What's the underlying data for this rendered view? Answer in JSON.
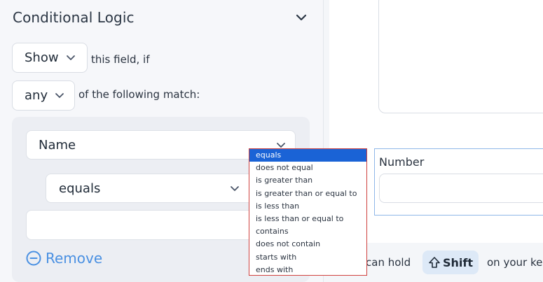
{
  "conditional_logic": {
    "title": "Conditional Logic",
    "action_select": {
      "value": "Show"
    },
    "action_suffix": "this field, if",
    "match_select": {
      "value": "any"
    },
    "match_suffix": "of the following match:",
    "rule": {
      "field_select": {
        "value": "Name"
      },
      "operator_select": {
        "value": "equals"
      },
      "value_input": {
        "value": ""
      },
      "remove_label": "Remove"
    }
  },
  "operator_dropdown": {
    "options": [
      "equals",
      "does not equal",
      "is greater than",
      "is greater than or equal to",
      "is less than",
      "is less than or equal to",
      "contains",
      "does not contain",
      "starts with",
      "ends with"
    ],
    "selected": "equals"
  },
  "preview": {
    "number_field_label": "Number",
    "hint_prefix": "can hold",
    "shift_key_label": "Shift",
    "hint_suffix": "on your ke"
  },
  "colors": {
    "accent": "#4a90e2",
    "dropdown_selected": "#1a63d6",
    "dropdown_border": "#d0423f",
    "field_highlight_border": "#8fb7e8"
  },
  "icons": {
    "collapse": "chevron-down-icon",
    "remove": "minus-circle-icon",
    "shift": "shift-arrow-icon"
  }
}
